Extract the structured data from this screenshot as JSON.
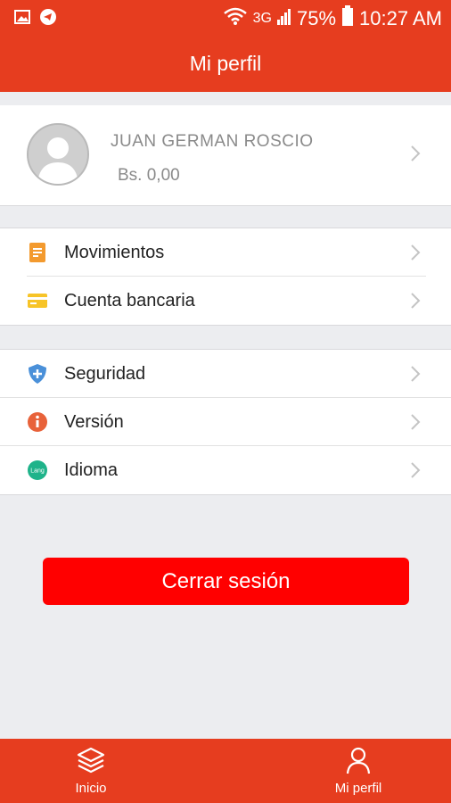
{
  "status_bar": {
    "network": "3G",
    "battery": "75%",
    "time": "10:27 AM"
  },
  "header": {
    "title": "Mi perfil"
  },
  "profile": {
    "name": "JUAN GERMAN ROSCIO",
    "balance": "Bs. 0,00"
  },
  "menu_group_1": [
    {
      "label": "Movimientos",
      "icon": "document-icon",
      "color": "#f39a2e"
    },
    {
      "label": "Cuenta bancaria",
      "icon": "card-icon",
      "color": "#f7c428"
    }
  ],
  "menu_group_2": [
    {
      "label": "Seguridad",
      "icon": "shield-icon",
      "color": "#4a90d9"
    },
    {
      "label": "Versión",
      "icon": "info-icon",
      "color": "#e8623a"
    },
    {
      "label": "Idioma",
      "icon": "language-icon",
      "color": "#1fb38a",
      "icon_text": "Lang"
    }
  ],
  "logout": {
    "label": "Cerrar sesión"
  },
  "bottom_nav": [
    {
      "label": "Inicio",
      "icon": "layers-icon"
    },
    {
      "label": "Mi perfil",
      "icon": "person-icon"
    }
  ],
  "colors": {
    "accent": "#e63d1f",
    "logout": "#ff0000",
    "background": "#ecedf0"
  }
}
